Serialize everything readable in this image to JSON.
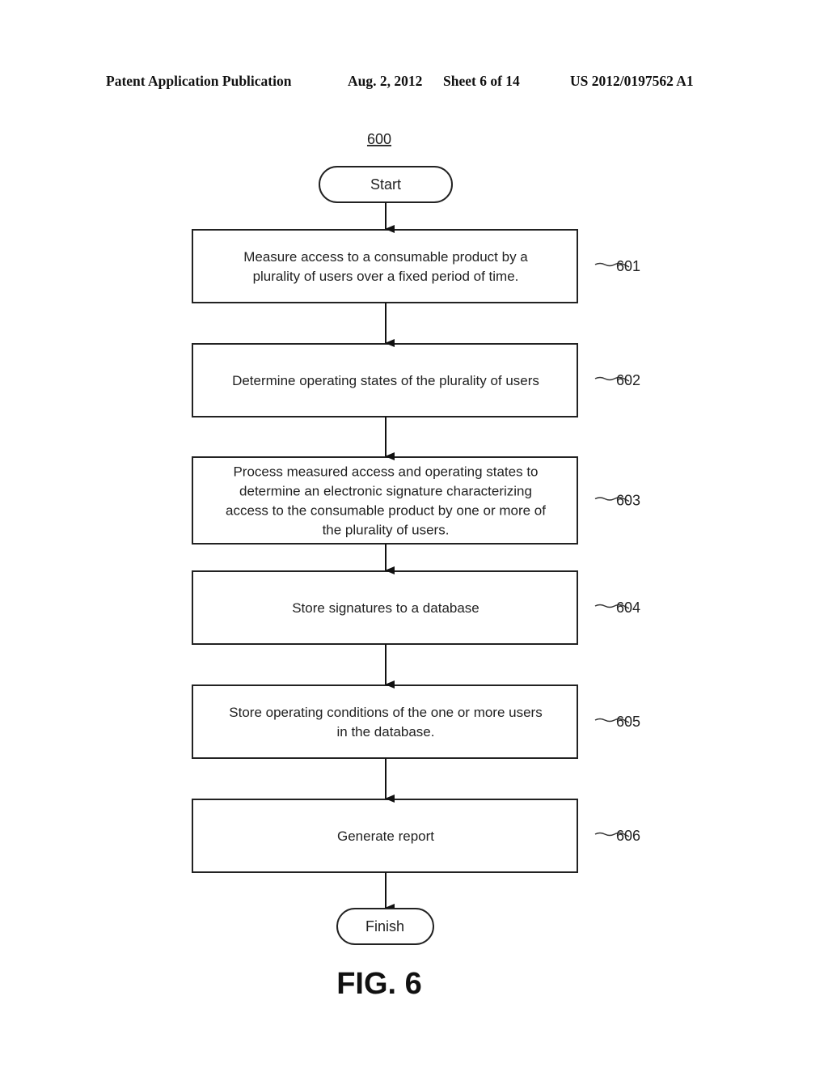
{
  "header": {
    "publication_type": "Patent Application Publication",
    "date": "Aug. 2, 2012",
    "sheet": "Sheet 6 of 14",
    "patent_number": "US 2012/0197562 A1"
  },
  "diagram": {
    "figure_ref": "600",
    "figure_label": "FIG. 6",
    "start_label": "Start",
    "finish_label": "Finish",
    "steps": [
      {
        "ref": "601",
        "lines": [
          "Measure access to a consumable product by a",
          "plurality of users over a fixed period of time."
        ]
      },
      {
        "ref": "602",
        "lines": [
          "Determine operating states of the plurality of users"
        ]
      },
      {
        "ref": "603",
        "lines": [
          "Process measured access and operating states to",
          "determine an electronic signature characterizing",
          "access to the consumable product by one or more of",
          "the plurality of users."
        ]
      },
      {
        "ref": "604",
        "lines": [
          "Store signatures to a database"
        ]
      },
      {
        "ref": "605",
        "lines": [
          "Store operating conditions of the one or more users",
          "in the database."
        ]
      },
      {
        "ref": "606",
        "lines": [
          "Generate report"
        ]
      }
    ]
  }
}
